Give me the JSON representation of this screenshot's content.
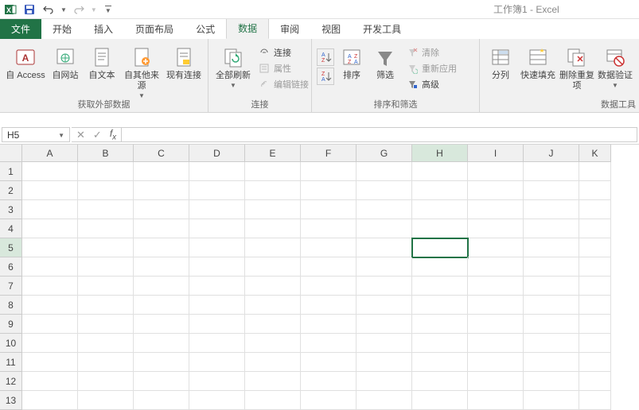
{
  "title": "工作簿1 - Excel",
  "qat": {
    "save_name": "save-icon",
    "undo_name": "undo-icon",
    "redo_name": "redo-icon"
  },
  "tabs": {
    "file": "文件",
    "items": [
      "开始",
      "插入",
      "页面布局",
      "公式",
      "数据",
      "审阅",
      "视图",
      "开发工具"
    ],
    "active_index": 4
  },
  "ribbon": {
    "group_external": {
      "label": "获取外部数据",
      "access": "自 Access",
      "web": "自网站",
      "text": "自文本",
      "other": "自其他来源",
      "existing": "现有连接"
    },
    "group_conn": {
      "label": "连接",
      "refresh": "全部刷新",
      "connections": "连接",
      "properties": "属性",
      "editlinks": "编辑链接"
    },
    "group_sort": {
      "label": "排序和筛选",
      "sort": "排序",
      "filter": "筛选",
      "clear": "清除",
      "reapply": "重新应用",
      "advanced": "高级"
    },
    "group_data": {
      "label": "数据工具",
      "textcol": "分列",
      "flash": "快速填充",
      "dedup": "删除重复项",
      "validate": "数据验证"
    }
  },
  "namebox": "H5",
  "columns": [
    "A",
    "B",
    "C",
    "D",
    "E",
    "F",
    "G",
    "H",
    "I",
    "J",
    "K"
  ],
  "rows": [
    1,
    2,
    3,
    4,
    5,
    6,
    7,
    8,
    9,
    10,
    11,
    12,
    13
  ],
  "selected_cell": {
    "col": "H",
    "row": 5
  },
  "colors": {
    "accent": "#217346"
  }
}
